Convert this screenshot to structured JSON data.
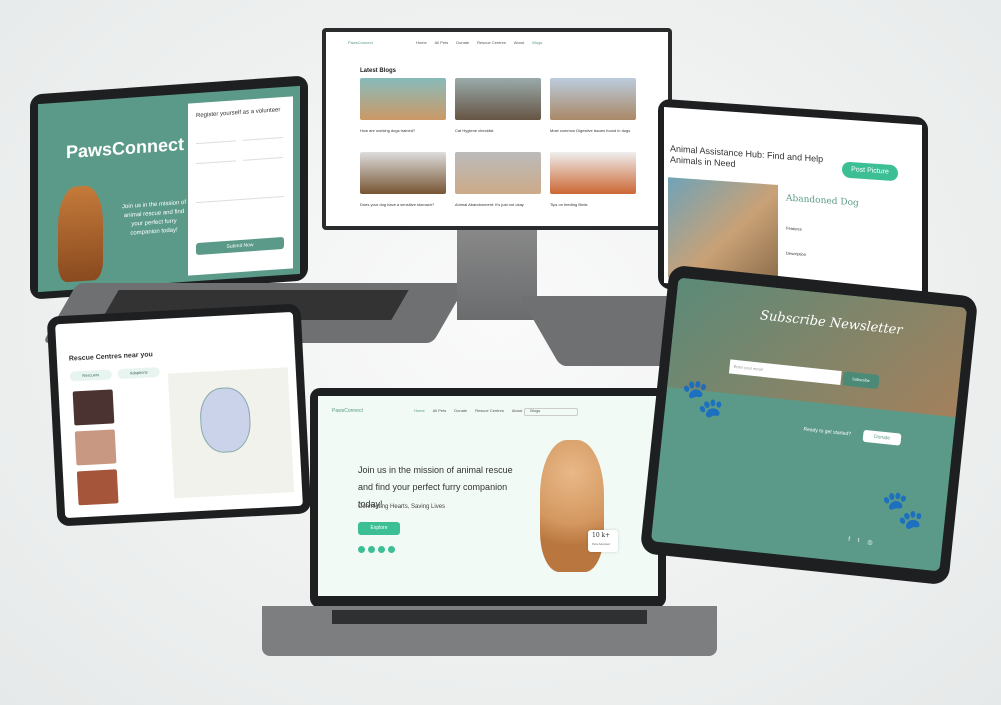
{
  "brand": "PawsConnect",
  "colors": {
    "accent": "#5b9a88",
    "accent_light": "#e8f4ef",
    "bezel": "#1e1f20"
  },
  "laptop_left": {
    "logo": "PawsConnect",
    "tagline": "Join us in the mission of animal rescue and find your perfect furry companion today!",
    "form_title": "Register yourself as a volunteer",
    "submit": "Submit Now"
  },
  "monitor": {
    "section_title": "Latest Blogs",
    "nav": [
      "Home",
      "All Pets",
      "Donate",
      "Rescue Centres",
      "About",
      "Blogs"
    ],
    "blogs": [
      {
        "title": "How are working dogs trained?"
      },
      {
        "title": "Cat Hygiene checklist"
      },
      {
        "title": "Most common Digestive issues found in dogs"
      },
      {
        "title": "Does your dog have a sensitive stomach?"
      },
      {
        "title": "Animal Abandonment: It's just not okay"
      },
      {
        "title": "Tips on feeding Birds"
      }
    ]
  },
  "laptop_right": {
    "title": "Animal Assistance Hub: Find and Help Animals in Need",
    "post_button": "Post Picture",
    "card_title": "Abandoned Dog",
    "features_label": "Features",
    "description_label": "Description"
  },
  "tablet_left": {
    "title": "Rescue Centres near you",
    "tabs": [
      "Rescuers",
      "Adoptions"
    ]
  },
  "laptop_center": {
    "nav": [
      "Home",
      "All Pets",
      "Donate",
      "Rescue Centres",
      "About",
      "Blogs"
    ],
    "headline": "Join us in the mission of animal rescue and find your perfect furry companion today!",
    "subline": "Connecting Hearts, Saving Lives",
    "cta": "Explore",
    "stat_value": "10 k+",
    "stat_label": "Pets Adopted"
  },
  "tablet_right": {
    "title": "Subscribe Newsletter",
    "input_placeholder": "Enter your email",
    "subscribe": "Subscribe",
    "ready_text": "Ready to get started?",
    "donate": "Donate"
  }
}
